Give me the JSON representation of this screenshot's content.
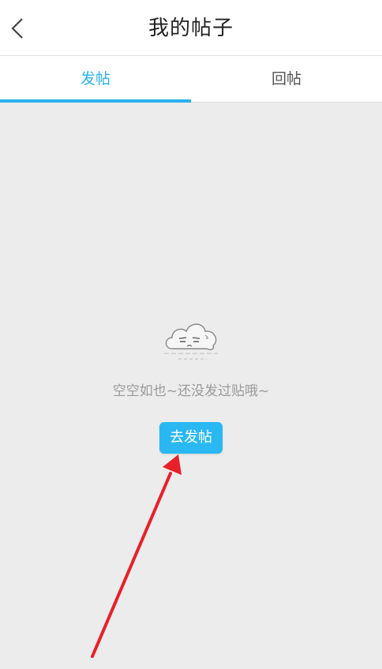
{
  "header": {
    "title": "我的帖子",
    "back_icon": "chevron-left-icon"
  },
  "tabs": [
    {
      "label": "发帖",
      "active": true
    },
    {
      "label": "回帖",
      "active": false
    }
  ],
  "empty_state": {
    "icon": "cloud-face-icon",
    "message": "空空如也~还没发过贴哦~",
    "button_label": "去发帖"
  },
  "colors": {
    "accent": "#2ab1ef",
    "button": "#2ab8f2",
    "annotation_arrow": "#e8202a",
    "background": "#ececec"
  }
}
